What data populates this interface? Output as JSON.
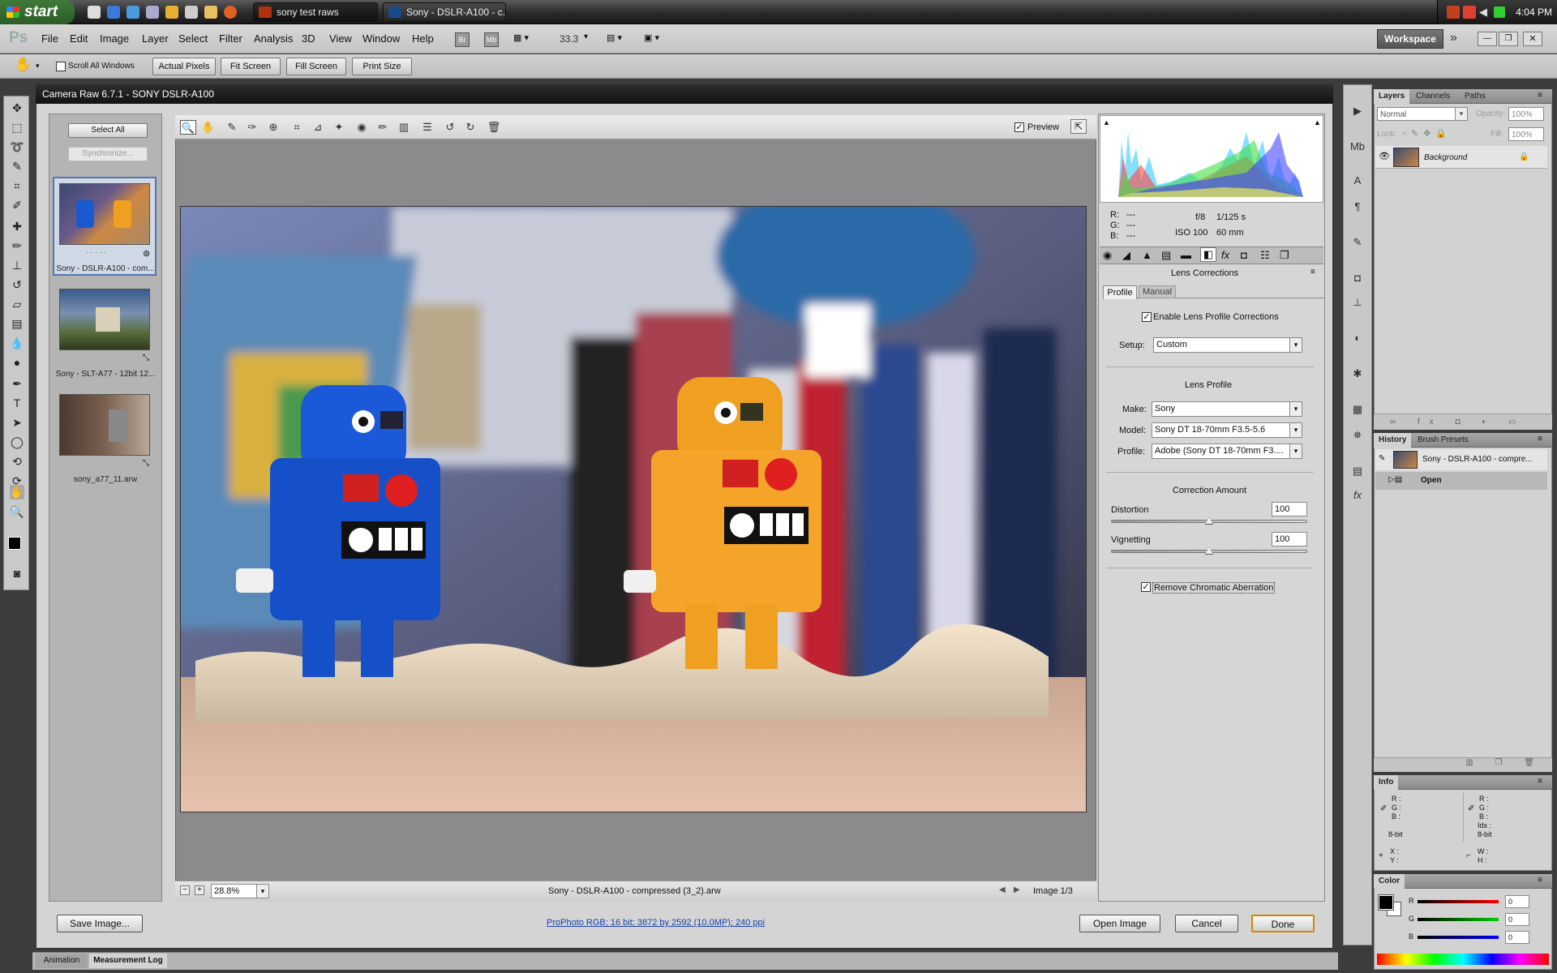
{
  "taskbar": {
    "start_label": "start",
    "tasks": [
      {
        "label": "sony test raws",
        "icon": "bridge-app-icon"
      },
      {
        "label": "Sony - DSLR-A100 - c...",
        "icon": "photoshop-app-icon"
      }
    ],
    "clock": "4:04 PM"
  },
  "menubar": {
    "logo": "Ps",
    "items": [
      "File",
      "Edit",
      "Image",
      "Layer",
      "Select",
      "Filter",
      "Analysis",
      "3D",
      "View",
      "Window",
      "Help"
    ],
    "zoom": "33.3",
    "workspace_label": "Workspace"
  },
  "options_bar": {
    "scroll_all_windows": "Scroll All Windows",
    "buttons": [
      "Actual Pixels",
      "Fit Screen",
      "Fill Screen",
      "Print Size"
    ]
  },
  "camera_raw": {
    "title": "Camera Raw 6.7.1  -  SONY DSLR-A100",
    "select_all": "Select All",
    "synchronize": "Synchronize...",
    "thumbnails": [
      {
        "label": "Sony - DSLR-A100 - com...",
        "selected": true
      },
      {
        "label": "Sony - SLT-A77 - 12bit 12...",
        "selected": false
      },
      {
        "label": "sony_a77_11.arw",
        "selected": false
      }
    ],
    "preview_label": "Preview",
    "zoom_value": "28.8%",
    "filename": "Sony - DSLR-A100 - compressed (3_2).arw",
    "image_counter": "Image 1/3",
    "readout": {
      "r": "R:",
      "g": "G:",
      "b": "B:",
      "r_val": "---",
      "g_val": "---",
      "b_val": "---",
      "aperture": "f/8",
      "shutter": "1/125 s",
      "iso": "ISO 100",
      "focal": "60 mm"
    },
    "panel_title": "Lens Corrections",
    "tabs": [
      "Profile",
      "Manual"
    ],
    "enable_profile": "Enable Lens Profile Corrections",
    "setup_label": "Setup:",
    "setup_value": "Custom",
    "lens_profile_heading": "Lens Profile",
    "make_label": "Make:",
    "make_value": "Sony",
    "model_label": "Model:",
    "model_value": "Sony DT 18-70mm F3.5-5.6",
    "profile_label": "Profile:",
    "profile_value": "Adobe (Sony DT 18-70mm F3....",
    "correction_heading": "Correction Amount",
    "distortion_label": "Distortion",
    "distortion_value": "100",
    "distortion_level": 0.5,
    "vignetting_label": "Vignetting",
    "vignetting_value": "100",
    "vignetting_level": 0.5,
    "remove_ca": "Remove Chromatic Aberration",
    "save_image": "Save Image...",
    "workflow_link": "ProPhoto RGB; 16 bit; 3872 by 2592 (10.0MP); 240 ppi",
    "open_image": "Open Image",
    "cancel": "Cancel",
    "done": "Done"
  },
  "layers_panel": {
    "tabs": [
      "Layers",
      "Channels",
      "Paths"
    ],
    "blend_mode": "Normal",
    "opacity_label": "Opacity:",
    "opacity_value": "100%",
    "lock_label": "Lock:",
    "fill_label": "Fill:",
    "fill_value": "100%",
    "layer_name": "Background"
  },
  "history_panel": {
    "tabs": [
      "History",
      "Brush Presets"
    ],
    "snapshot": "Sony - DSLR-A100 - compre...",
    "step": "Open"
  },
  "info_panel": {
    "title": "Info",
    "left": [
      "R :",
      "G :",
      "B :"
    ],
    "left_bit": "8-bit",
    "right": [
      "R :",
      "G :",
      "B :",
      "Idx :"
    ],
    "right_bit": "8-bit",
    "xy": [
      "X :",
      "Y :"
    ],
    "wh": [
      "W :",
      "H :"
    ]
  },
  "color_panel": {
    "title": "Color",
    "channels": [
      "R",
      "G",
      "B"
    ],
    "values": [
      "0",
      "0",
      "0"
    ]
  },
  "bottom_tabs": [
    "Animation",
    "Measurement Log"
  ],
  "colors": {
    "accent": "#1a44aa",
    "done_border": "#d08a00"
  }
}
